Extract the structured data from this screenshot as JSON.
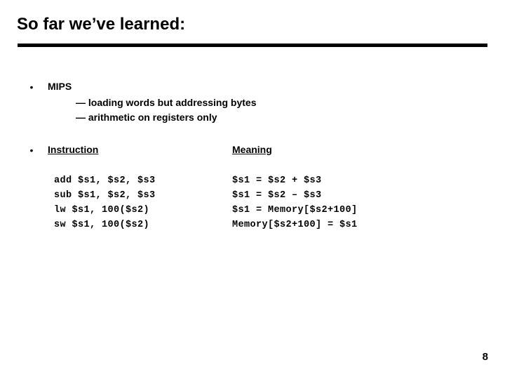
{
  "slide": {
    "title": "So far we’ve learned:",
    "page_number": "8",
    "bullet_glyph": "•"
  },
  "bullets": [
    {
      "label": "MIPS",
      "sub_items": [
        "— loading words but addressing bytes",
        "— arithmetic on registers only"
      ]
    }
  ],
  "table": {
    "headers": {
      "instruction": "Instruction",
      "meaning": "Meaning"
    },
    "rows": [
      {
        "instruction": "add $s1, $s2, $s3",
        "meaning": "$s1 = $s2 + $s3"
      },
      {
        "instruction": "sub $s1, $s2, $s3",
        "meaning": "$s1 = $s2 – $s3"
      },
      {
        "instruction": "lw $s1, 100($s2)",
        "meaning": "$s1 = Memory[$s2+100]"
      },
      {
        "instruction": "sw $s1, 100($s2)",
        "meaning": "Memory[$s2+100] = $s1"
      }
    ]
  },
  "colors": {
    "background": "#ffffff",
    "text": "#000000",
    "rule": "#000000"
  }
}
